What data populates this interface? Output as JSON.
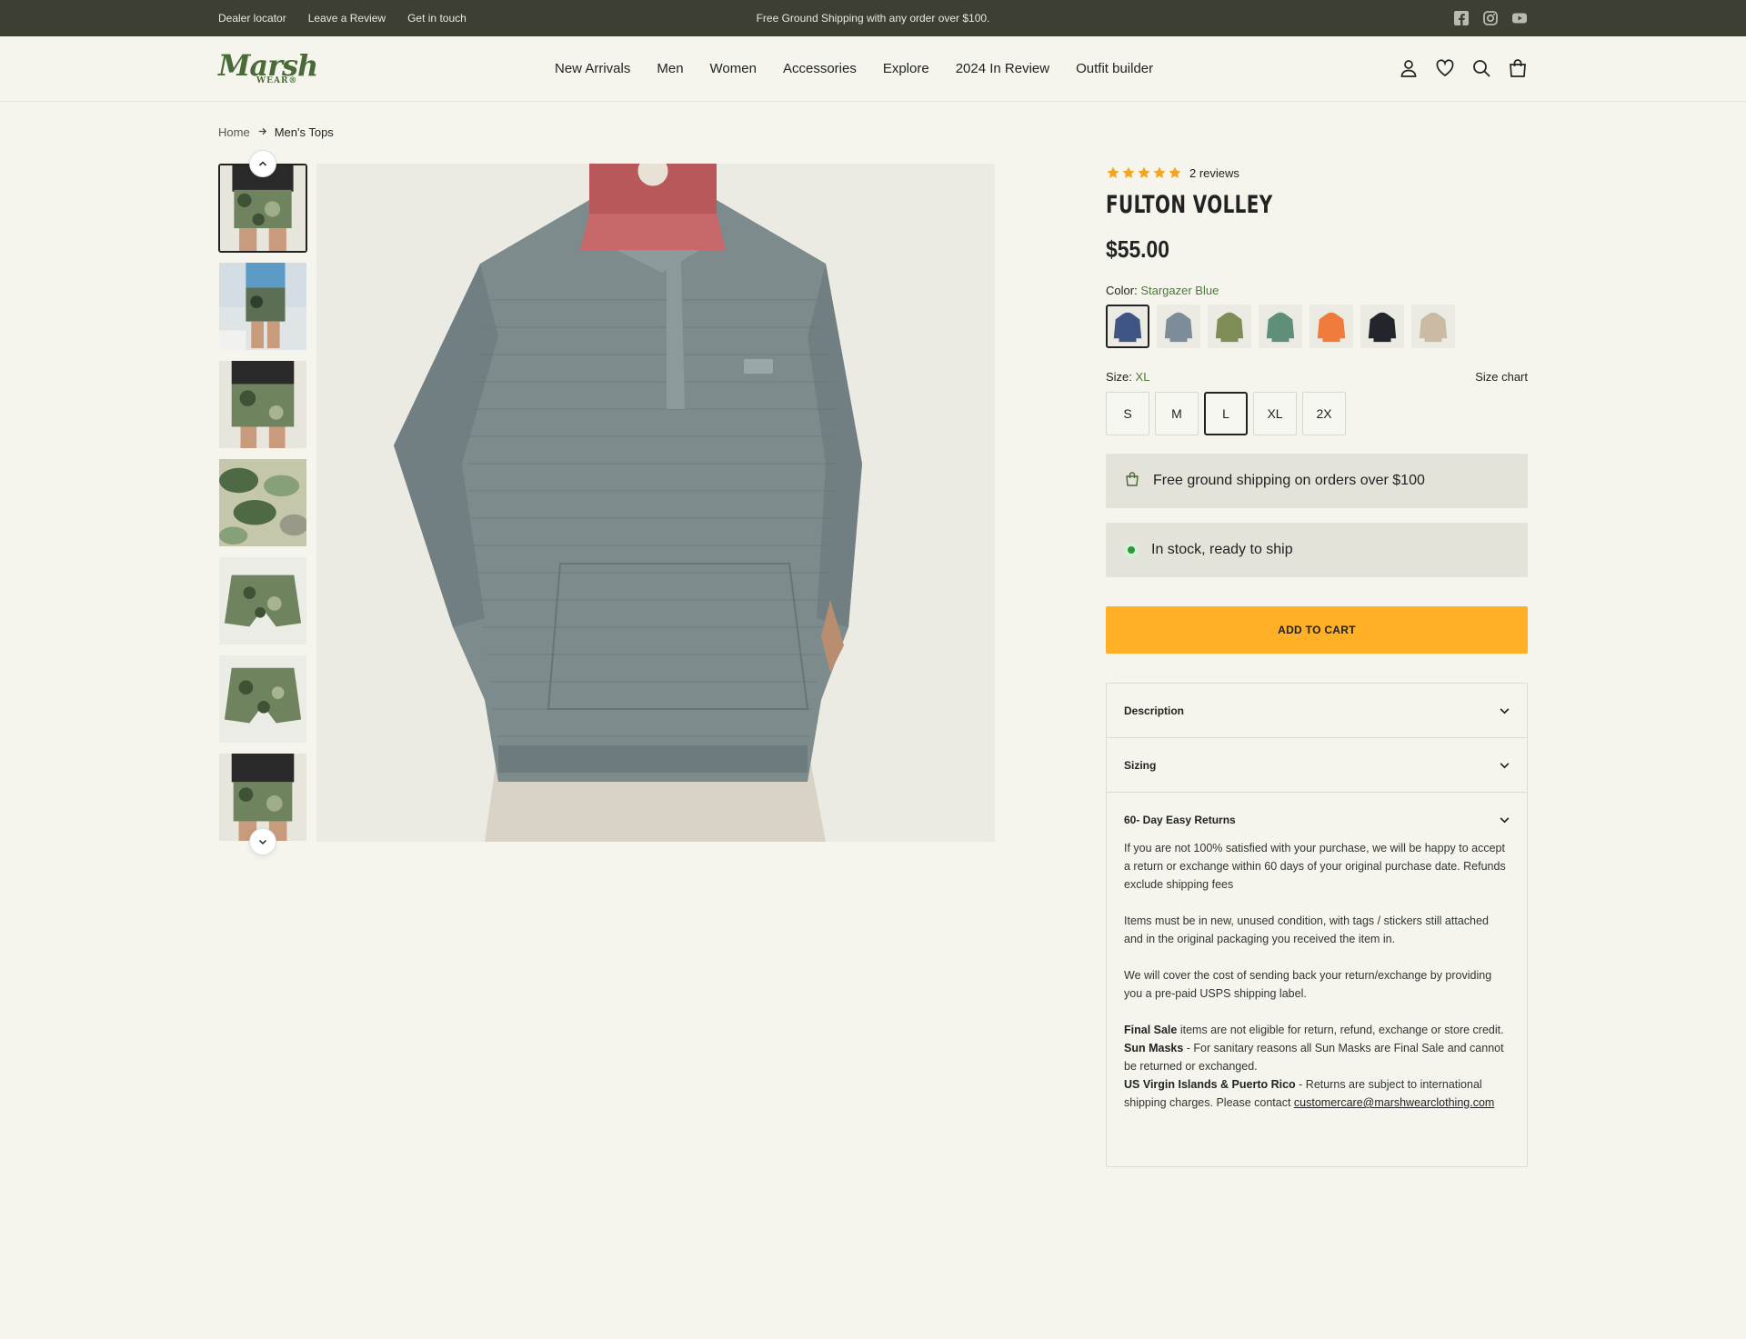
{
  "topbar": {
    "links": [
      "Dealer locator",
      "Leave a Review",
      "Get in touch"
    ],
    "promo": "Free Ground Shipping with any order over $100.",
    "social": [
      "facebook-icon",
      "instagram-icon",
      "youtube-icon"
    ]
  },
  "header": {
    "logo_text": "Marsh",
    "logo_sub": "WEAR®",
    "nav": [
      "New Arrivals",
      "Men",
      "Women",
      "Accessories",
      "Explore",
      "2024 In Review",
      "Outfit builder"
    ],
    "icons": [
      "account-icon",
      "wishlist-heart-icon",
      "search-icon",
      "cart-bag-icon"
    ]
  },
  "breadcrumb": {
    "home": "Home",
    "current": "Men's Tops"
  },
  "gallery": {
    "thumbnails": [
      "camo-shorts-front",
      "camo-shorts-beach",
      "camo-shorts-side",
      "camo-pattern-closeup",
      "camo-shorts-flat-front",
      "camo-shorts-flat-back",
      "camo-shorts-front-2"
    ],
    "main_image": "hoodie-model-front"
  },
  "product": {
    "rating": 5,
    "reviews": "2 reviews",
    "title": "FULTON VOLLEY",
    "price": "$55.00",
    "color_label": "Color:",
    "color_value": "Stargazer Blue",
    "swatch_colors": [
      "#3f5583",
      "#7d8c99",
      "#7e8c55",
      "#5f8e7a",
      "#ee7a3c",
      "#23252d",
      "#cbbba4"
    ],
    "size_label": "Size:",
    "size_value": "XL",
    "size_chart": "Size chart",
    "sizes": [
      "S",
      "M",
      "L",
      "XL",
      "2X"
    ],
    "selected_size": "L",
    "shipping_notice": "Free ground shipping on orders over $100",
    "stock_notice": "In stock, ready to ship",
    "add_to_cart": "ADD TO CART"
  },
  "accordion": {
    "description": "Description",
    "sizing": "Sizing",
    "returns": "60- Day Easy Returns",
    "returns_p1": "If you are not 100% satisfied with your purchase, we will be happy to accept a return or exchange within 60 days of your original purchase date. Refunds exclude shipping fees",
    "returns_p2": "Items must be in new, unused condition, with tags / stickers still attached and in the original packaging you received the item in.",
    "returns_p3": "We will cover the cost of sending back your return/exchange by providing you a pre-paid USPS shipping label.",
    "final_sale_bold": "Final Sale",
    "final_sale_text": " items are not eligible for return, refund, exchange or store credit.",
    "sun_masks_bold": "Sun Masks",
    "sun_masks_text": " - For sanitary reasons all Sun Masks are Final Sale and cannot be returned or exchanged.",
    "usvi_bold": "US Virgin Islands & Puerto Rico",
    "usvi_text": " - Returns are subject to international shipping charges. Please contact ",
    "email": "customercare@marshwearclothing.com"
  },
  "colors": {
    "topbar_bg": "#3c3f32",
    "brand_green": "#4a6a38",
    "accent_yellow": "#ffb027",
    "star_orange": "#f5a524",
    "stock_green": "#2a9a3c"
  }
}
